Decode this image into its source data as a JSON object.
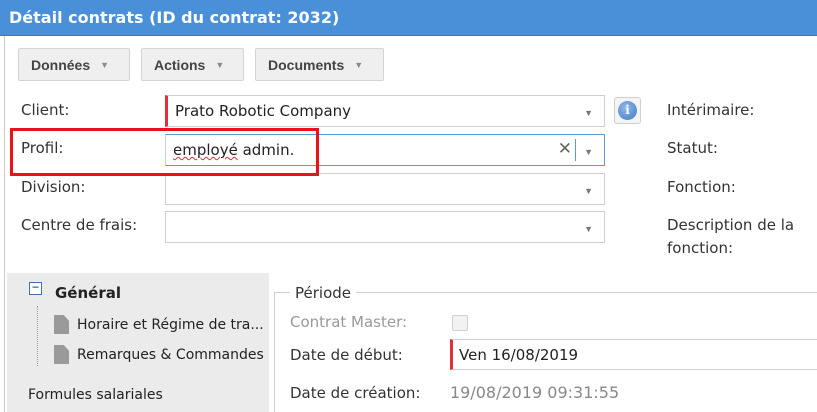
{
  "window": {
    "title": "Détail contrats (ID du contrat: 2032)"
  },
  "toolbar": {
    "buttons": [
      {
        "label": "Données"
      },
      {
        "label": "Actions"
      },
      {
        "label": "Documents"
      }
    ],
    "caret_glyph": "▼"
  },
  "form": {
    "client": {
      "label": "Client:",
      "value": "Prato Robotic Company"
    },
    "profil": {
      "label": "Profil:",
      "value_part1": "employé",
      "value_part2": " admin."
    },
    "division": {
      "label": "Division:",
      "value": ""
    },
    "centre": {
      "label": "Centre de frais:",
      "value": ""
    },
    "clear_glyph": "✕",
    "dropdown_glyph": "▼",
    "info_glyph": "i"
  },
  "right_labels": {
    "interimaire": "Intérimaire:",
    "statut": "Statut:",
    "fonction": "Fonction:",
    "description_line1": "Description de la",
    "description_line2": "fonction:"
  },
  "sidebar": {
    "toggle_glyph": "−",
    "root": "Général",
    "items": [
      {
        "label": "Horaire et Régime de tra..."
      },
      {
        "label": "Remarques & Commandes"
      }
    ],
    "link": "Formules salariales"
  },
  "periode": {
    "legend": "Période",
    "contrat_master": {
      "label": "Contrat Master:",
      "checked": false
    },
    "date_debut": {
      "label": "Date de début:",
      "value": "Ven 16/08/2019"
    },
    "date_creation": {
      "label": "Date de création:",
      "value": "19/08/2019 09:31:55"
    }
  },
  "colors": {
    "titlebar": "#4a90d9",
    "required": "#e0303a",
    "highlight": "#e8121c"
  }
}
